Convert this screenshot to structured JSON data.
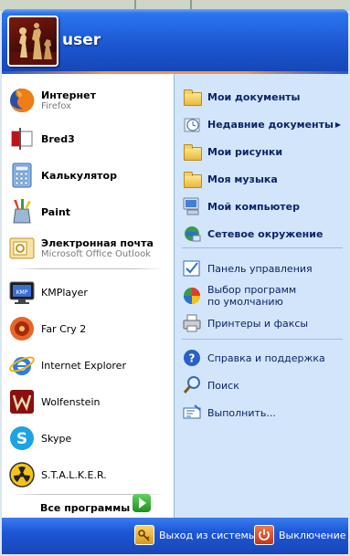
{
  "user": {
    "name": "user"
  },
  "pinned": [
    {
      "name": "Интернет",
      "sub": "Firefox"
    },
    {
      "name": "Bred3"
    },
    {
      "name": "Калькулятор"
    },
    {
      "name": "Paint"
    },
    {
      "name": "Электронная почта",
      "sub": "Microsoft Office Outlook"
    }
  ],
  "recent": [
    "KMPlayer",
    "Far Cry 2",
    "Internet Explorer",
    "Wolfenstein",
    "Skype",
    "S.T.A.L.K.E.R."
  ],
  "all_programs": "Все программы",
  "places": [
    "Мои документы",
    "Недавние документы",
    "Мои рисунки",
    "Моя музыка",
    "Мой компьютер",
    "Сетевое окружение"
  ],
  "system": [
    "Панель управления",
    "Выбор программ по умолчанию",
    "Принтеры и факсы"
  ],
  "help": [
    "Справка и поддержка",
    "Поиск",
    "Выполнить..."
  ],
  "footer": {
    "logoff": "Выход из системы",
    "shutdown": "Выключение"
  },
  "colors": {
    "header": "#1b56cf",
    "places_bg": "#d3e5fa",
    "accent_bar": "#f1963a",
    "link_text": "#0a246a"
  }
}
